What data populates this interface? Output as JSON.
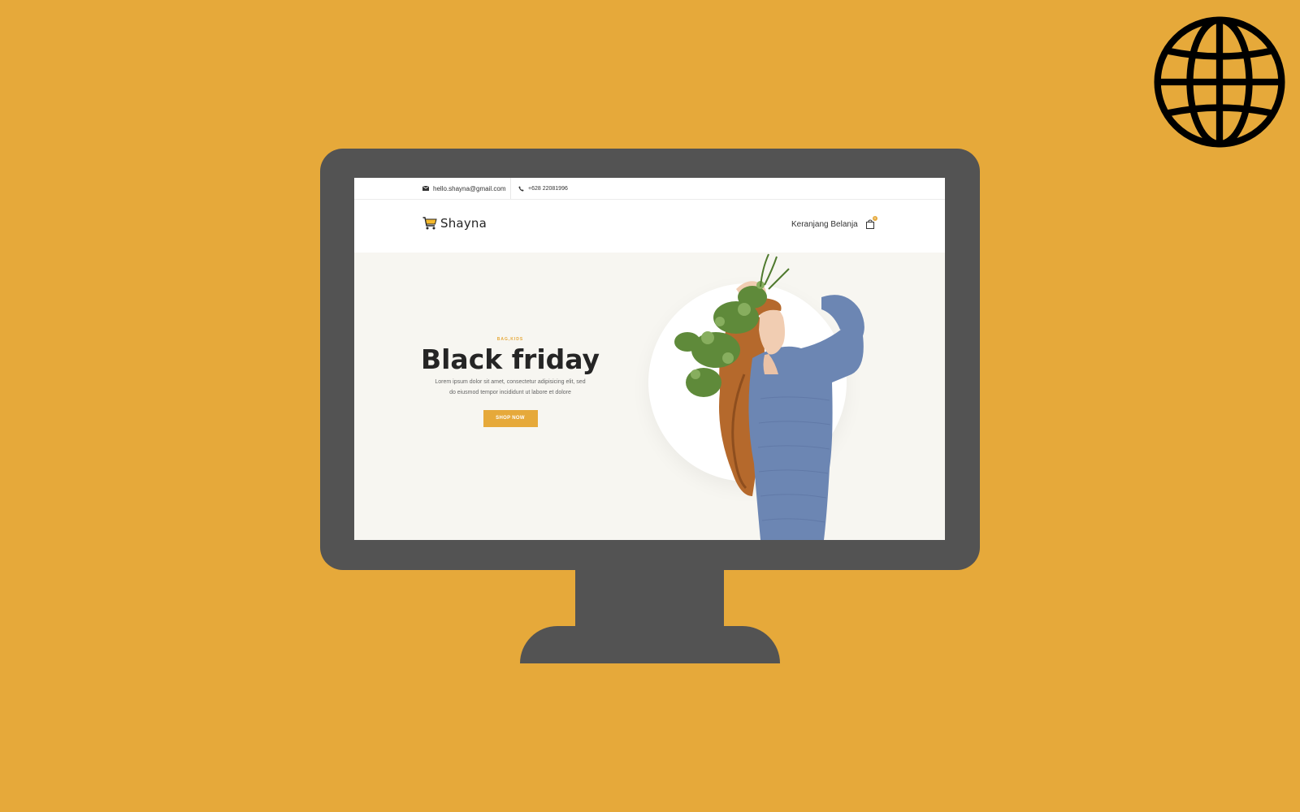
{
  "topbar": {
    "email": "hello.shayna@gmail.com",
    "phone": "+628 22081996",
    "email_icon": "envelope-icon",
    "phone_icon": "phone-icon"
  },
  "header": {
    "logo_text": "Shayna",
    "logo_icon": "shopping-cart-icon",
    "cart_label": "Keranjang Belanja",
    "cart_icon": "shopping-bag-icon",
    "cart_count": "0"
  },
  "hero": {
    "category": "BAG,KIDS",
    "title": "Black friday",
    "description_line1": "Lorem ipsum dolor sit amet, consectetur adipisicing elit, sed",
    "description_line2": "do eiusmod tempor incididunt ut labore et dolore",
    "button_label": "SHOP NOW"
  },
  "decor": {
    "corner_icon": "globe-icon"
  },
  "colors": {
    "background": "#E6A93A",
    "monitor": "#535353",
    "accent": "#E6A93A",
    "hero_bg": "#F7F6F1",
    "sweater": "#6C86B3",
    "hair": "#B5692C"
  }
}
